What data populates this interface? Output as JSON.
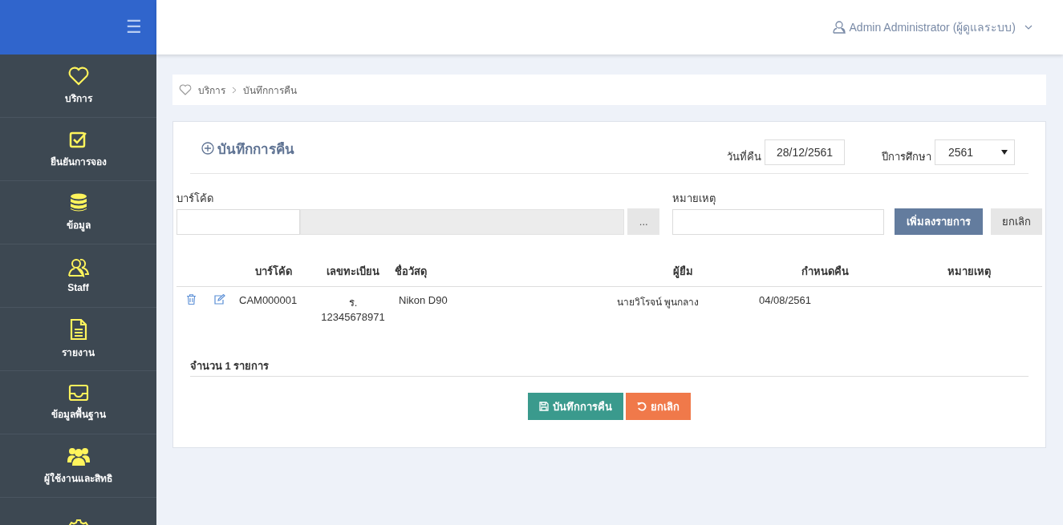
{
  "sidebar": {
    "menu_icon": "☰",
    "items": [
      {
        "kind": "labeled",
        "label": "บริการ"
      },
      {
        "kind": "labeled",
        "label": "ยืนยันการจอง"
      },
      {
        "kind": "labeled",
        "label": "ข้อมูล"
      },
      {
        "kind": "labeled",
        "label": "Staff"
      },
      {
        "kind": "labeled",
        "label": "รายงาน"
      },
      {
        "kind": "labeled",
        "label": "ข้อมูลพื้นฐาน"
      },
      {
        "kind": "labeled",
        "label": "ผู้ใช้งานและสิทธิ"
      },
      {
        "kind": "icon_only"
      }
    ]
  },
  "header": {
    "user": "Admin Administrator (ผู้ดูแลระบบ)"
  },
  "breadcrumb": [
    "บริการ",
    "บันทึกการคืน"
  ],
  "form": {
    "title": "บันทึกการคืน",
    "return_date_label": "วันที่คืน",
    "return_date": "28/12/2561",
    "year_label": "ปีการศึกษา",
    "year": "2561",
    "barcode_label": "บาร์โค้ด",
    "browse_button": "...",
    "remark_label": "หมายเหตุ",
    "add_button": "เพิ่มลงรายการ",
    "clear_button": "ยกเลิก"
  },
  "table": {
    "columns": [
      "บาร์โค้ด",
      "เลขทะเบียน",
      "ชื่อวัสดุ",
      "ผู้ยืม",
      "กำหนดคืน",
      "หมายเหตุ"
    ],
    "rows": [
      {
        "barcode": "CAM000001",
        "registration": "ร. 12345678971",
        "item": "Nikon D90",
        "borrower": "นายวิโรจน์ พูนกลาง",
        "due": "04/08/2561"
      }
    ]
  },
  "total": "จำนวน 1 รายการ",
  "buttons": [
    {
      "kind": "save",
      "label": "บันทึกการคืน"
    },
    {
      "kind": "cancel",
      "label": "ยกเลิก"
    }
  ]
}
